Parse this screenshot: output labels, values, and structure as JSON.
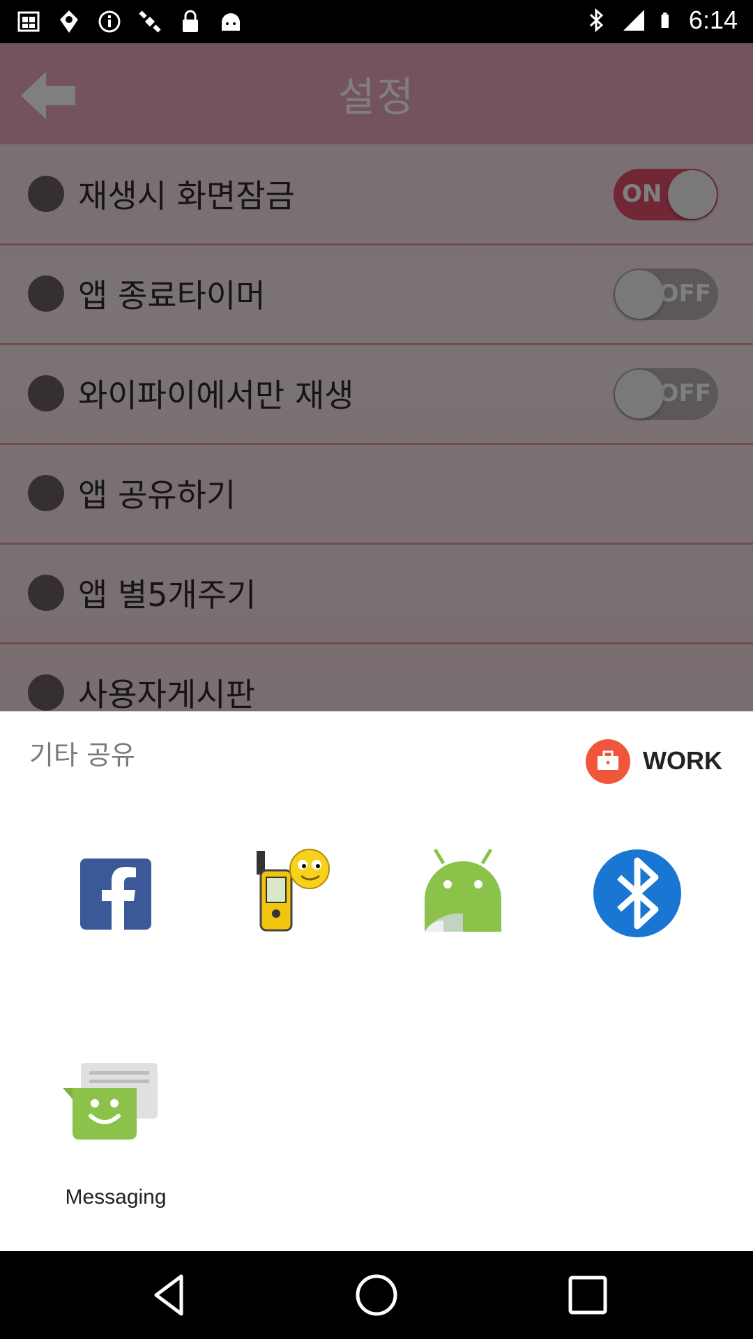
{
  "status_bar": {
    "time": "6:14",
    "icons": [
      "gallery-icon",
      "fake-gps-icon",
      "info-icon",
      "satellite-icon",
      "lock-icon",
      "android-icon",
      "bluetooth-icon",
      "signal-icon",
      "battery-icon"
    ]
  },
  "background_app": {
    "title": "설정",
    "rows": [
      {
        "label": "재생시 화면잠금",
        "icon": "lock-icon",
        "toggle": "ON"
      },
      {
        "label": "앱 종료타이머",
        "icon": "clock-icon",
        "toggle": "OFF"
      },
      {
        "label": "와이파이에서만 재생",
        "icon": "wifi-icon",
        "toggle": "OFF"
      },
      {
        "label": "앱 공유하기",
        "icon": "share-icon"
      },
      {
        "label": "앱 별5개주기",
        "icon": "star-icon"
      },
      {
        "label": "사용자게시판",
        "icon": "clipboard-icon"
      }
    ]
  },
  "share_sheet": {
    "title": "기타 공유",
    "work_label": "WORK",
    "apps": [
      {
        "name": "facebook-app",
        "label": ""
      },
      {
        "name": "gps-app",
        "label": ""
      },
      {
        "name": "android-beam-app",
        "label": ""
      },
      {
        "name": "bluetooth-app",
        "label": ""
      },
      {
        "name": "messaging-app",
        "label": "Messaging"
      }
    ]
  },
  "nav_bar": {
    "buttons": [
      "back-icon",
      "home-icon",
      "recents-icon"
    ]
  },
  "colors": {
    "header": "#e9a6b8",
    "toggle_on": "#e44e6e",
    "work_badge": "#f0573a",
    "facebook": "#3b5998",
    "android": "#8bc34a",
    "bluetooth": "#1976d2",
    "messaging": "#8bc34a"
  }
}
